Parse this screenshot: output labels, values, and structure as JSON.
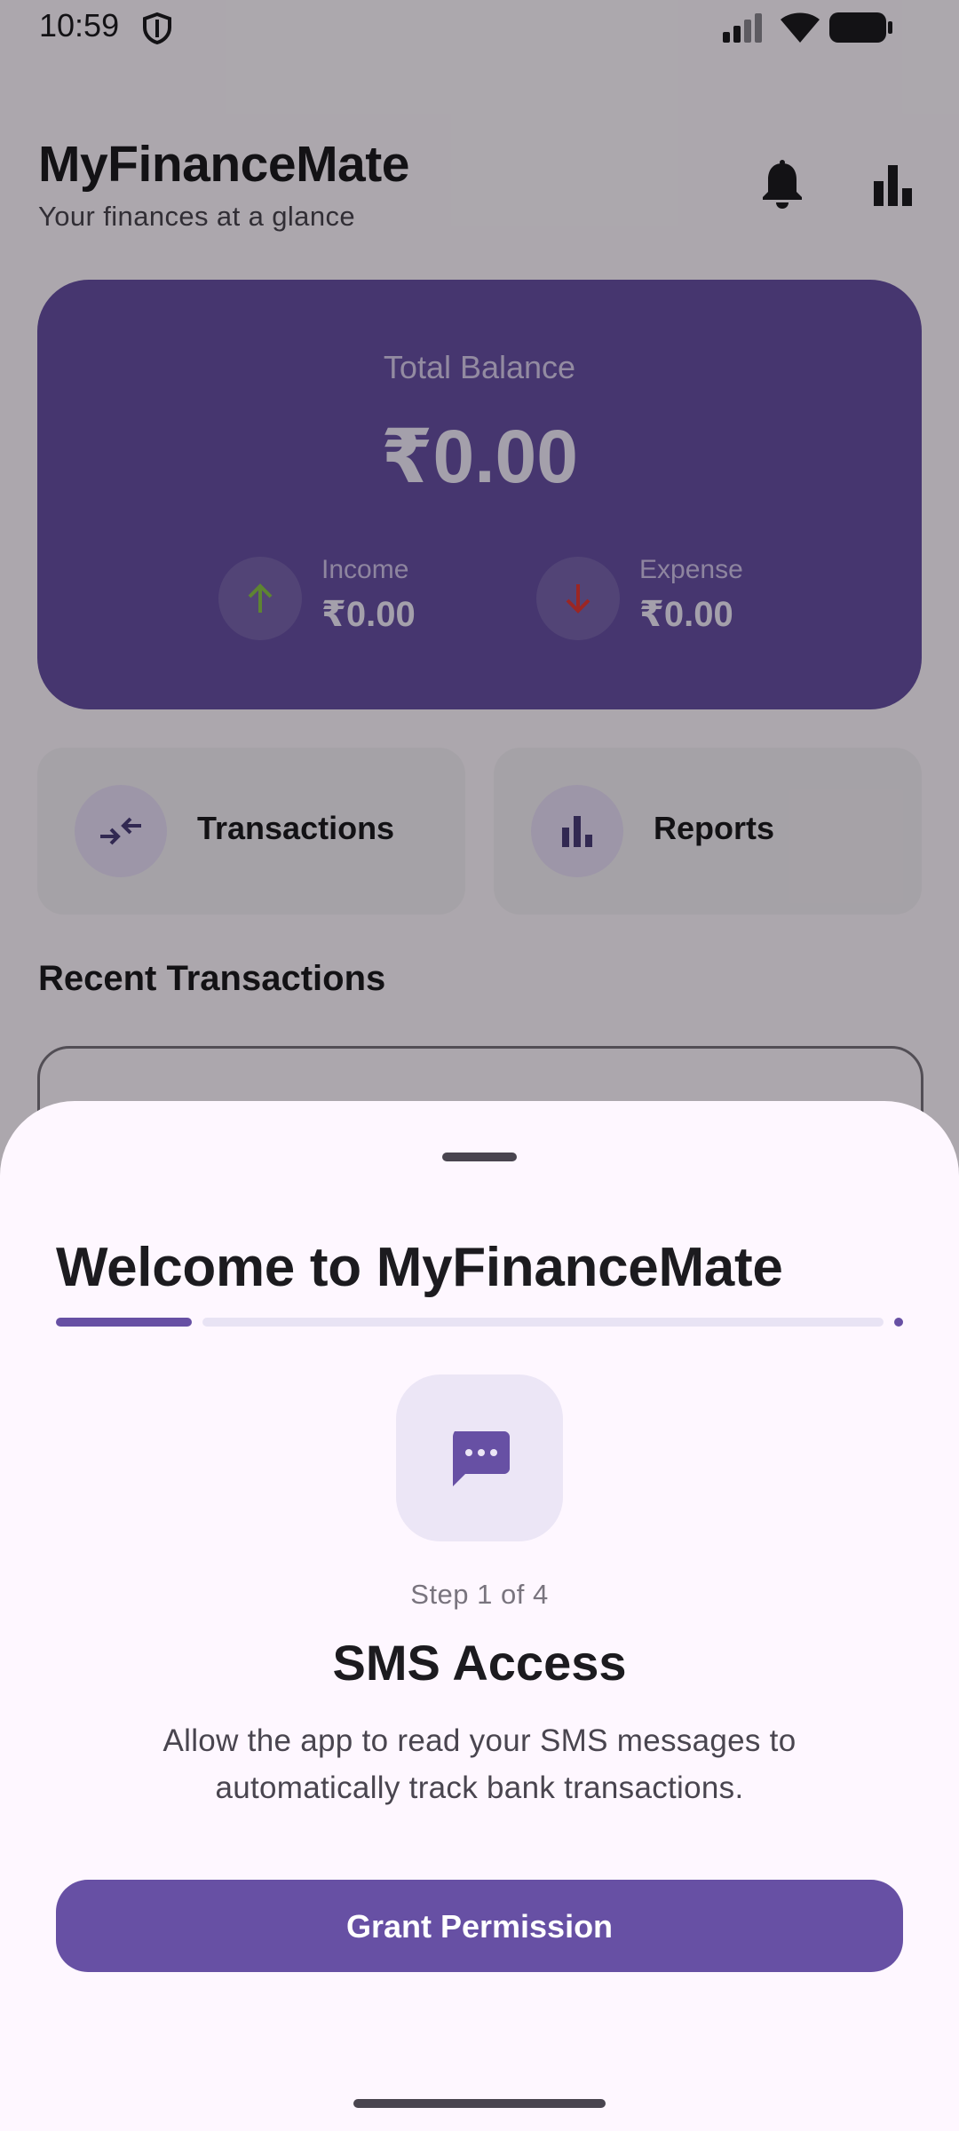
{
  "status_bar": {
    "time": "10:59"
  },
  "header": {
    "title": "MyFinanceMate",
    "subtitle": "Your finances at a glance",
    "icons": [
      "bell-icon",
      "bar-chart-icon"
    ]
  },
  "balance_card": {
    "label": "Total Balance",
    "value": "₹0.00",
    "income": {
      "label": "Income",
      "value": "₹0.00",
      "icon": "arrow-up-icon"
    },
    "expense": {
      "label": "Expense",
      "value": "₹0.00",
      "icon": "arrow-down-icon"
    }
  },
  "quick_actions": [
    {
      "label": "Transactions",
      "icon": "swap-arrows-icon"
    },
    {
      "label": "Reports",
      "icon": "bar-chart-icon"
    }
  ],
  "recent": {
    "title": "Recent Transactions"
  },
  "sheet": {
    "title": "Welcome to MyFinanceMate",
    "progress": {
      "step": 1,
      "total": 4
    },
    "step_icon": "sms-icon",
    "step_label": "Step 1 of 4",
    "step_title": "SMS Access",
    "step_description": "Allow the app to read your SMS messages to automatically track bank transactions.",
    "button_label": "Grant Permission"
  },
  "colors": {
    "primary": "#6750a4",
    "surface": "#fef7ff",
    "income_icon": "#8bc34a",
    "expense_icon": "#e53935"
  }
}
